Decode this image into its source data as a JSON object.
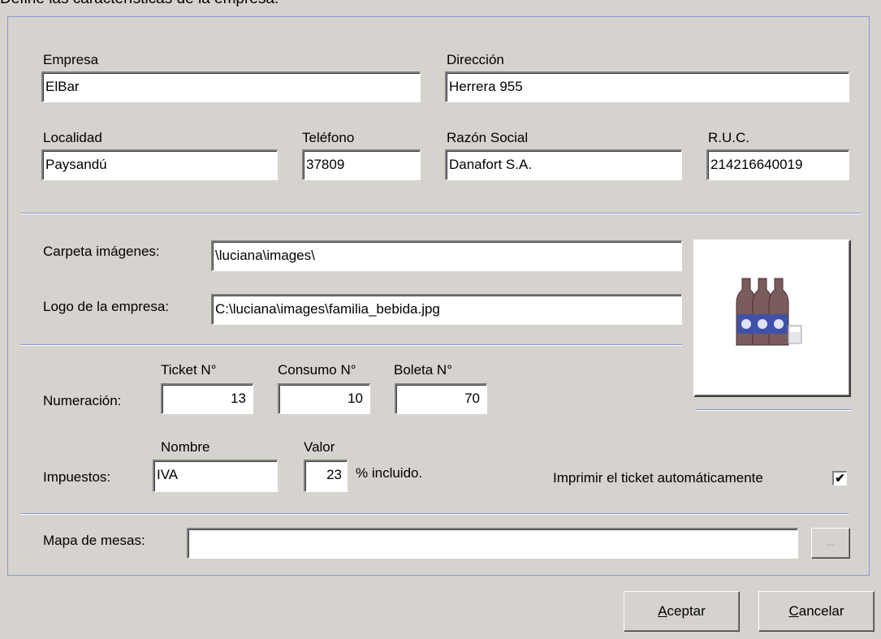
{
  "header": {
    "text": "Define las características de la empresa."
  },
  "company": {
    "empresa_label": "Empresa",
    "empresa_value": "ElBar",
    "direccion_label": "Dirección",
    "direccion_value": "Herrera 955",
    "localidad_label": "Localidad",
    "localidad_value": "Paysandú",
    "telefono_label": "Teléfono",
    "telefono_value": "37809",
    "razon_label": "Razón Social",
    "razon_value": "Danafort S.A.",
    "ruc_label": "R.U.C.",
    "ruc_value": "214216640019"
  },
  "images": {
    "carpeta_label": "Carpeta imágenes:",
    "carpeta_value": "\\luciana\\images\\",
    "logo_label": "Logo de la empresa:",
    "logo_value": "C:\\luciana\\images\\familia_bebida.jpg",
    "logo_preview_icon": "bottles-icon"
  },
  "numbering": {
    "label": "Numeración:",
    "ticket_label": "Ticket N°",
    "ticket_value": "13",
    "consumo_label": "Consumo N°",
    "consumo_value": "10",
    "boleta_label": "Boleta N°",
    "boleta_value": "70"
  },
  "taxes": {
    "label": "Impuestos:",
    "nombre_label": "Nombre",
    "nombre_value": "IVA",
    "valor_label": "Valor",
    "valor_value": "23",
    "incluido_text": "% incluido.",
    "print_label": "Imprimir el ticket automáticamente",
    "print_checked": true,
    "check_mark": "✔"
  },
  "map": {
    "label": "Mapa de mesas:",
    "value": "",
    "browse_label": "..."
  },
  "buttons": {
    "accept_label": "Aceptar",
    "cancel_label": "Cancelar"
  },
  "colors": {
    "background": "#d6d3ce",
    "separator": "#8f95c8"
  }
}
